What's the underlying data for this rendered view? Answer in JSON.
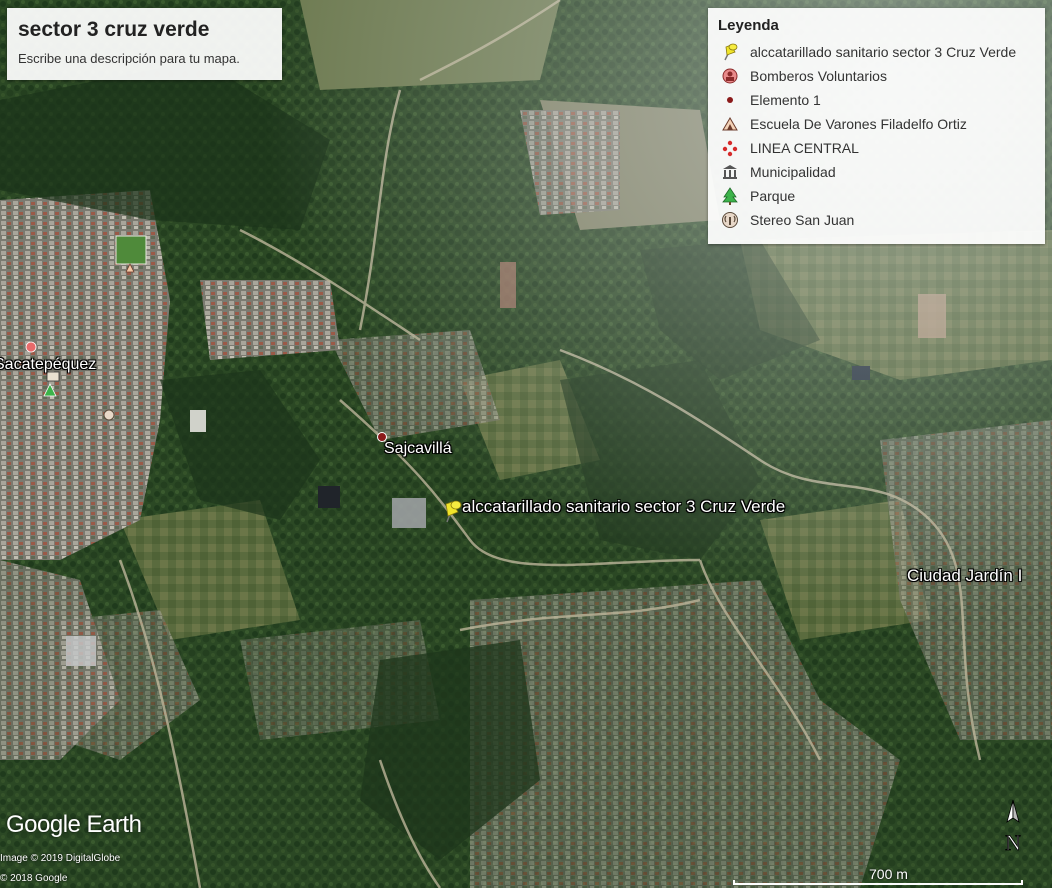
{
  "map": {
    "title": "sector 3 cruz verde",
    "description": "Escribe una descripción para tu mapa."
  },
  "legend": {
    "title": "Leyenda",
    "items": [
      {
        "label": "alccatarillado sanitario sector 3 Cruz Verde",
        "icon": "yellow-pushpin-icon"
      },
      {
        "label": "Bomberos Voluntarios",
        "icon": "firefighter-icon"
      },
      {
        "label": "Elemento 1",
        "icon": "red-dot-icon"
      },
      {
        "label": "Escuela De Varones Filadelfo Ortiz",
        "icon": "school-icon"
      },
      {
        "label": "LINEA CENTRAL",
        "icon": "red-dots-icon"
      },
      {
        "label": "Municipalidad",
        "icon": "municipal-building-icon"
      },
      {
        "label": "Parque",
        "icon": "park-tree-icon"
      },
      {
        "label": "Stereo San Juan",
        "icon": "radio-icon"
      }
    ]
  },
  "places": {
    "sacatepequez": "Sacatepéquez",
    "sajcavilla": "Sajcavillá",
    "pin_label": "alccatarillado sanitario sector 3  Cruz Verde",
    "ciudad_jardin": "Ciudad Jardín I"
  },
  "attribution": {
    "logo": "Google Earth",
    "imagery": "Image © 2019 DigitalGlobe",
    "copyright": "© 2018 Google"
  },
  "scale": {
    "label": "700 m"
  },
  "compass": {
    "label": "N"
  },
  "colors": {
    "vegetation_dark": "#1f3a1c",
    "vegetation": "#2f4f27",
    "urban": "#8a8a86",
    "road": "#b9b39b",
    "pin": "#f0e52a",
    "dot": "#8b1a1a"
  }
}
